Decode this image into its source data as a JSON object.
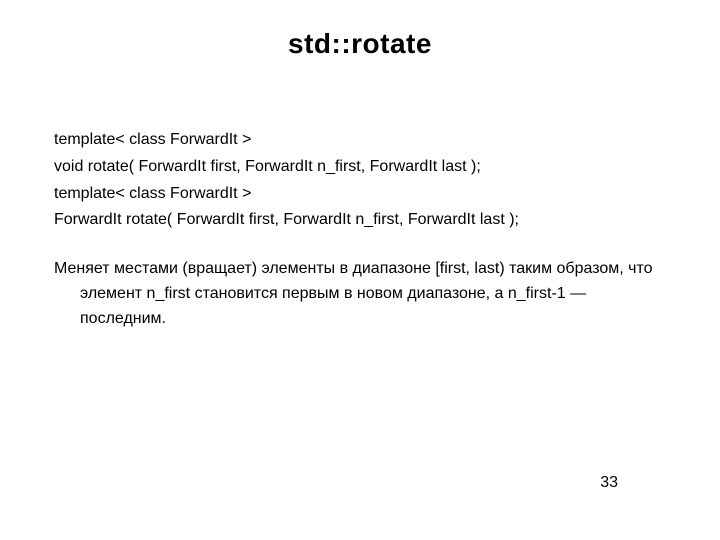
{
  "title": "std::rotate",
  "signatures": [
    "template< class ForwardIt >",
    "void rotate( ForwardIt first, ForwardIt n_first, ForwardIt last );",
    "template< class ForwardIt >",
    "ForwardIt rotate( ForwardIt first, ForwardIt n_first, ForwardIt last );"
  ],
  "description": "Меняет местами (вращает) элементы в диапазоне [first, last) таким образом, что элемент n_first становится первым в новом диапазоне, а n_first-1 — последним.",
  "page_number": "33"
}
